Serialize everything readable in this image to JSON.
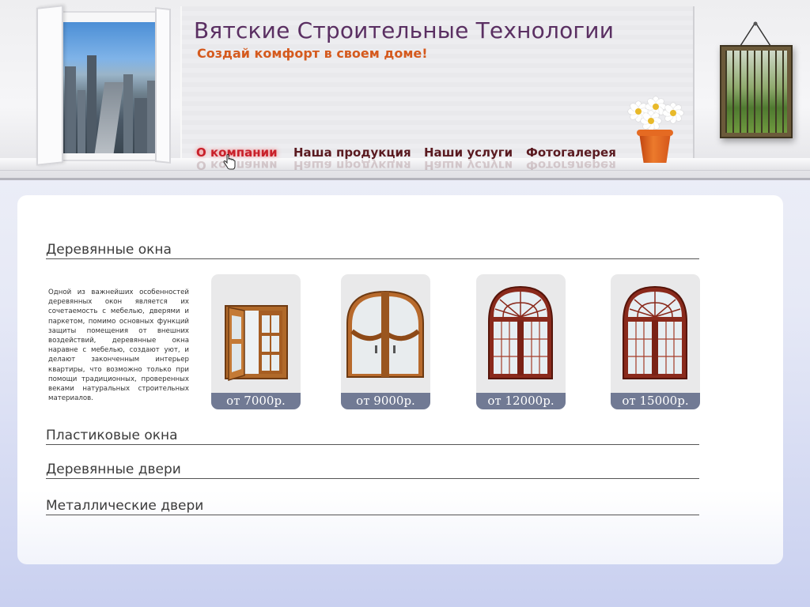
{
  "header": {
    "title": "Вятские Строительные Технологии",
    "slogan": "Создай комфорт в своем доме!"
  },
  "nav": {
    "items": [
      {
        "label": "О компании",
        "active": true
      },
      {
        "label": "Наша продукция",
        "active": false
      },
      {
        "label": "Наши услуги",
        "active": false
      },
      {
        "label": "Фотогалерея",
        "active": false
      }
    ]
  },
  "sections": [
    {
      "title": "Деревянные окна"
    },
    {
      "title": "Пластиковые окна"
    },
    {
      "title": "Деревянные двери"
    },
    {
      "title": "Металлические двери"
    }
  ],
  "description": "Одной из важнейших особенностей деревянных окон является их сочетаемость с мебелью, дверями и паркетом, помимо основных функций защиты помещения от внешних воздействий, деревянные окна наравне с мебелью, создают уют, и делают законченным интерьер квартиры, что возможно только при помощи традиционных, проверенных веками натуральных строительных материалов.",
  "products": [
    {
      "price": "от 7000р.",
      "icon": "open-wood-window-icon"
    },
    {
      "price": "от 9000р.",
      "icon": "arched-wood-window-icon"
    },
    {
      "price": "от 12000р.",
      "icon": "fanlight-arched-window-icon"
    },
    {
      "price": "от 15000р.",
      "icon": "fanlight-arched-window-icon"
    }
  ],
  "colors": {
    "title": "#5a2f62",
    "slogan": "#d55a1e",
    "nav": "#5a1a20",
    "nav_active": "#c8202a",
    "price_bar": "#717a94"
  }
}
